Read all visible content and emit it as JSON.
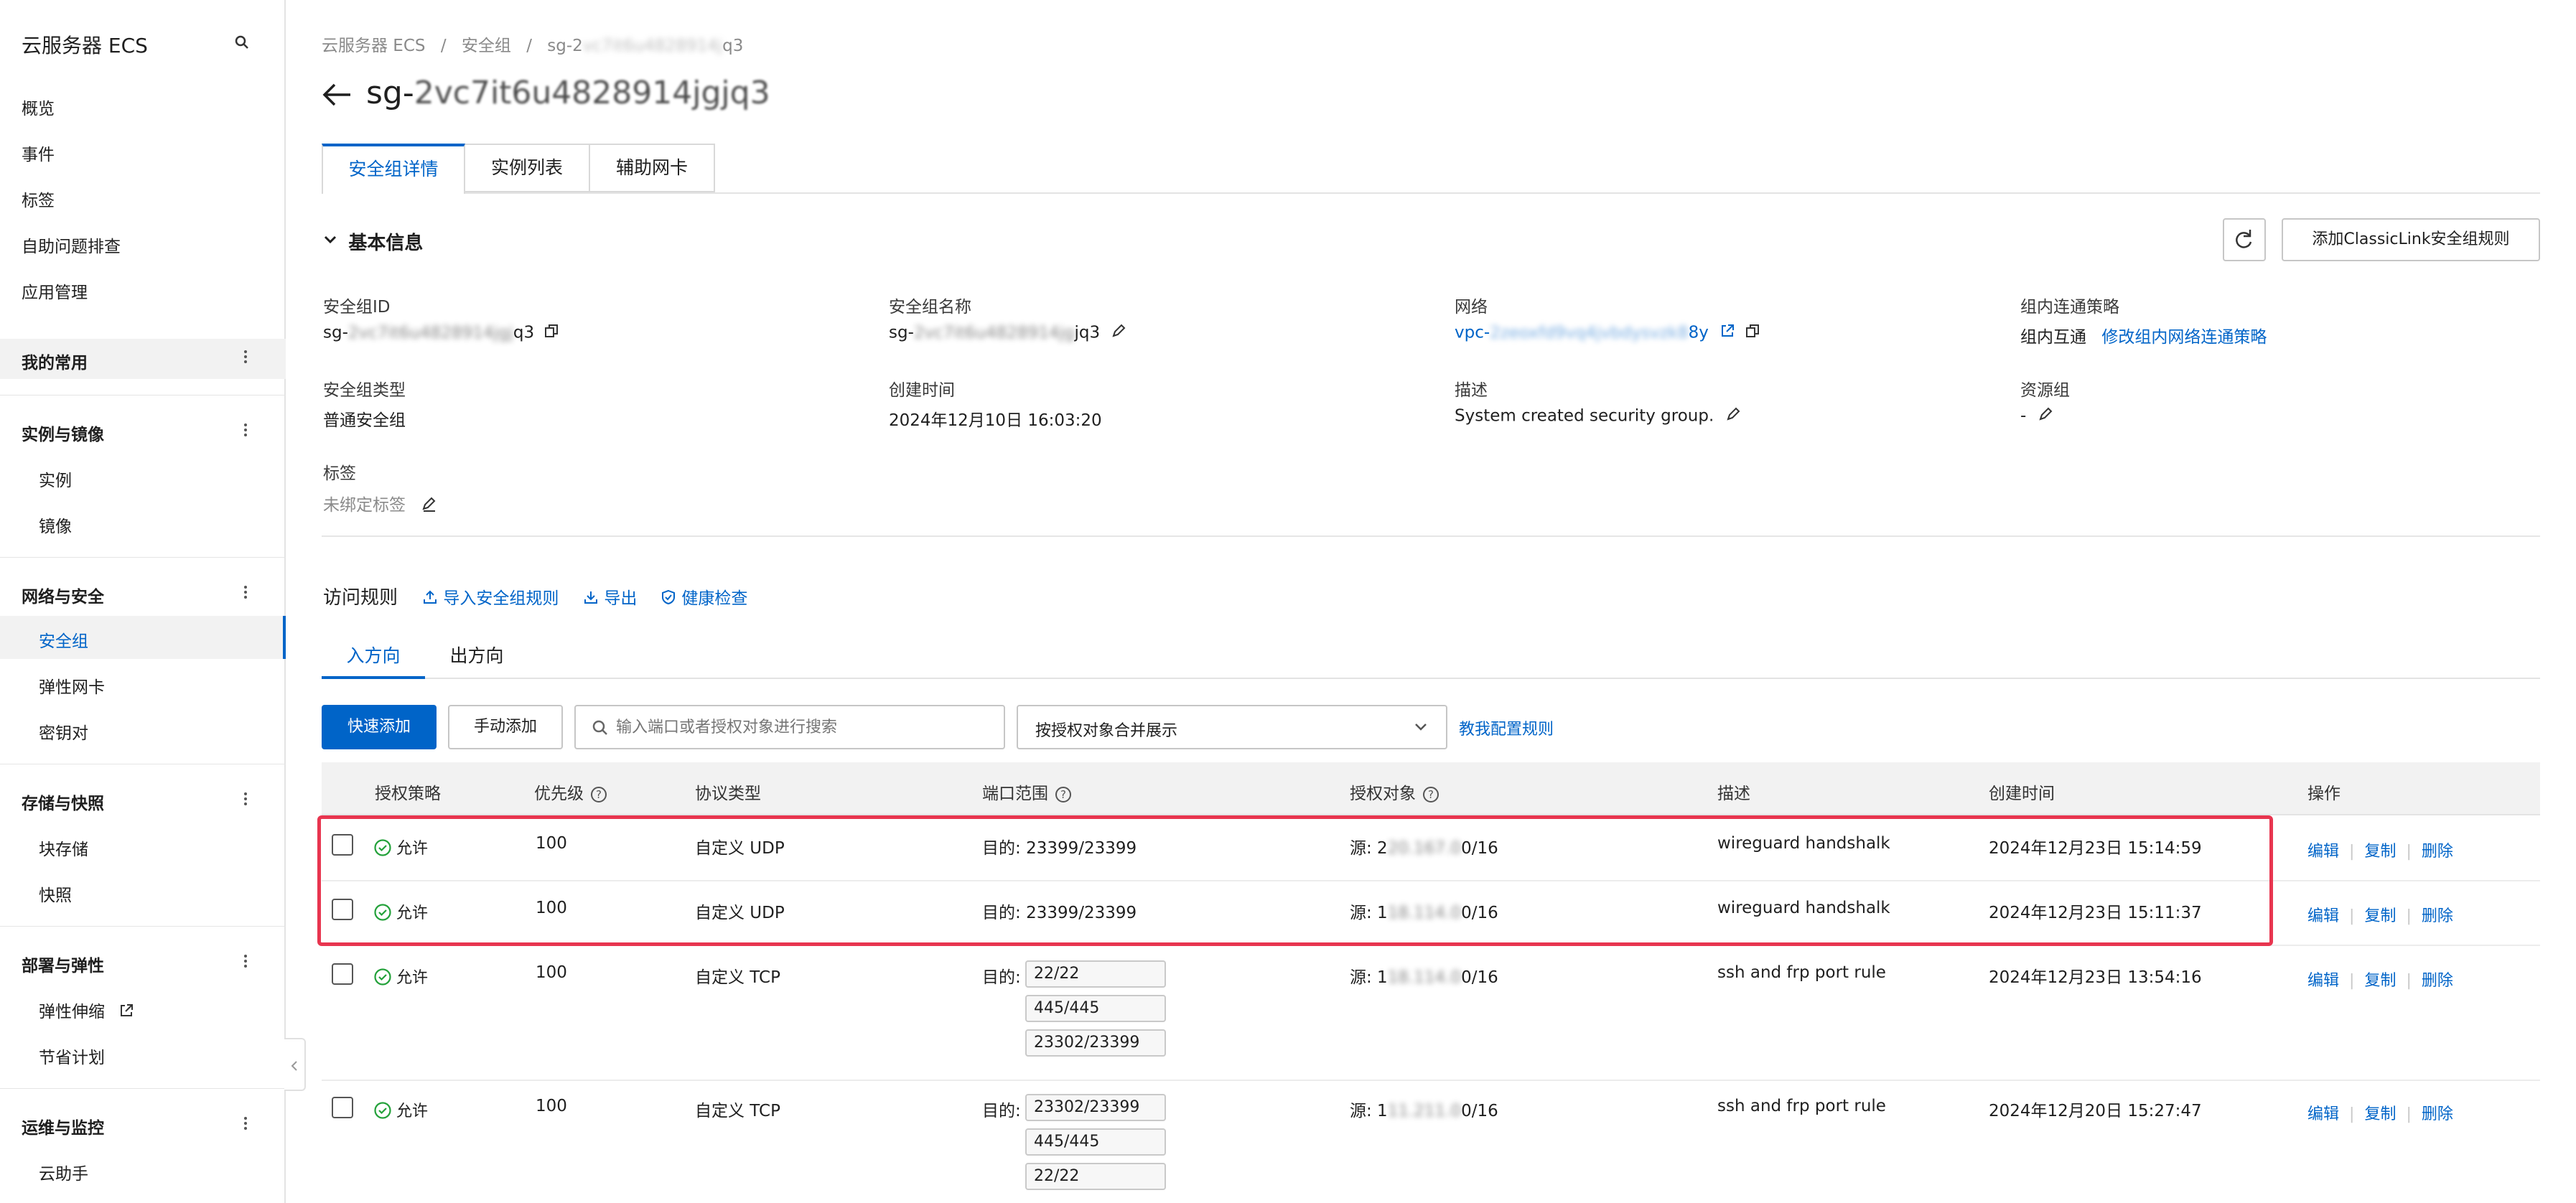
{
  "sidebar": {
    "title": "云服务器 ECS",
    "top_items": [
      "概览",
      "事件",
      "标签",
      "自助问题排查",
      "应用管理"
    ],
    "favorites": "我的常用",
    "sections": [
      {
        "title": "实例与镜像",
        "items": [
          "实例",
          "镜像"
        ]
      },
      {
        "title": "网络与安全",
        "items": [
          "安全组",
          "弹性网卡",
          "密钥对"
        ]
      },
      {
        "title": "存储与快照",
        "items": [
          "块存储",
          "快照"
        ]
      },
      {
        "title": "部署与弹性",
        "items": [
          "弹性伸缩",
          "节省计划"
        ]
      },
      {
        "title": "运维与监控",
        "items": [
          "云助手"
        ]
      }
    ]
  },
  "breadcrumb": {
    "items": [
      "云服务器 ECS",
      "安全组"
    ],
    "sep": "/",
    "current_prefix": "sg-2",
    "current_blurred": "vc7it6u4828914j",
    "current_suffix": "q3"
  },
  "page_title": {
    "prefix": "sg-",
    "blurred": "2vc7it6u4828914jgjq3"
  },
  "tabs": [
    "安全组详情",
    "实例列表",
    "辅助网卡"
  ],
  "basic_info": {
    "section_title": "基本信息",
    "add_classiclink": "添加ClassicLink安全组规则",
    "fields": {
      "sg_id": {
        "label": "安全组ID",
        "prefix": "sg-",
        "blurred": "2vc7it6u4828914jgj",
        "suffix": "q3"
      },
      "sg_name": {
        "label": "安全组名称",
        "prefix": "sg-",
        "blurred": "2vc7it6u4828914jg",
        "suffix": "jq3"
      },
      "network": {
        "label": "网络",
        "prefix": "vpc-",
        "blurred": "2zeoxfd9vq4jvbdysvzk8",
        "suffix": "8y"
      },
      "intra_policy": {
        "label": "组内连通策略",
        "value": "组内互通",
        "link": "修改组内网络连通策略"
      },
      "sg_type": {
        "label": "安全组类型",
        "value": "普通安全组"
      },
      "created": {
        "label": "创建时间",
        "value": "2024年12月10日 16:03:20"
      },
      "desc": {
        "label": "描述",
        "value": "System created security group."
      },
      "resource_group": {
        "label": "资源组",
        "value": "-"
      },
      "tags": {
        "label": "标签",
        "value": "未绑定标签"
      }
    }
  },
  "rules": {
    "title": "访问规则",
    "actions": [
      "导入安全组规则",
      "导出",
      "健康检查"
    ],
    "direction_tabs": [
      "入方向",
      "出方向"
    ],
    "quick_add": "快速添加",
    "manual_add": "手动添加",
    "search_placeholder": "输入端口或者授权对象进行搜索",
    "merge_select": "按授权对象合并展示",
    "teach_link": "教我配置规则",
    "columns": [
      "授权策略",
      "优先级",
      "协议类型",
      "端口范围",
      "授权对象",
      "描述",
      "创建时间",
      "操作"
    ],
    "row_ops": [
      "编辑",
      "复制",
      "删除"
    ],
    "rows": [
      {
        "policy": "允许",
        "priority": "100",
        "protocol": "自定义 UDP",
        "port_prefix": "目的:",
        "ports": [
          "23399/23399"
        ],
        "src_prefix": "源: 2",
        "src_blurred": "20.167.0",
        "src_suffix": "0/16",
        "desc": "wireguard handshalk",
        "created": "2024年12月23日 15:14:59",
        "highlight": true
      },
      {
        "policy": "允许",
        "priority": "100",
        "protocol": "自定义 UDP",
        "port_prefix": "目的:",
        "ports": [
          "23399/23399"
        ],
        "src_prefix": "源: 1",
        "src_blurred": "18.114.0",
        "src_suffix": "0/16",
        "desc": "wireguard handshalk",
        "created": "2024年12月23日 15:11:37",
        "highlight": true
      },
      {
        "policy": "允许",
        "priority": "100",
        "protocol": "自定义 TCP",
        "port_prefix": "目的:",
        "ports": [
          "22/22",
          "445/445",
          "23302/23399"
        ],
        "src_prefix": "源: 1",
        "src_blurred": "18.114.0",
        "src_suffix": "0/16",
        "desc": "ssh and frp port rule",
        "created": "2024年12月23日 13:54:16",
        "highlight": false
      },
      {
        "policy": "允许",
        "priority": "100",
        "protocol": "自定义 TCP",
        "port_prefix": "目的:",
        "ports": [
          "23302/23399",
          "445/445",
          "22/22"
        ],
        "src_prefix": "源: 1",
        "src_blurred": "11.211.0",
        "src_suffix": "0/16",
        "desc": "ssh and frp port rule",
        "created": "2024年12月20日 15:27:47",
        "highlight": false
      }
    ]
  },
  "colors": {
    "accent": "#0064c8",
    "highlight_border": "#e8354f",
    "success": "#23a13a"
  }
}
